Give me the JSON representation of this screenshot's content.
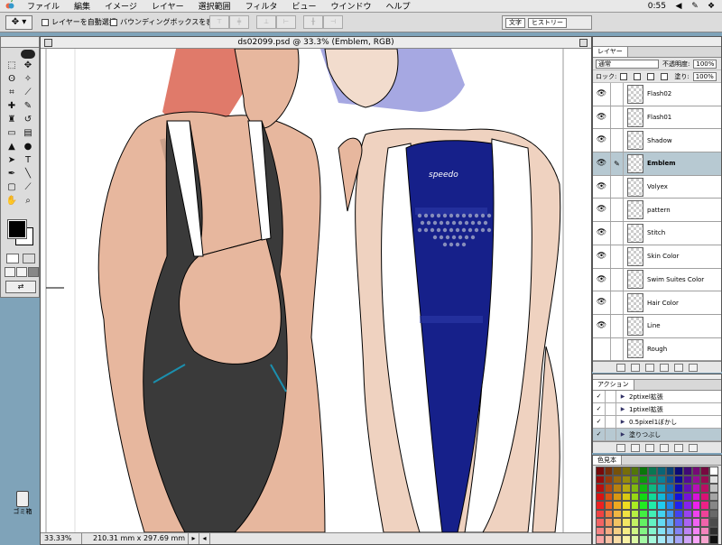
{
  "menubar": {
    "apple": "",
    "items": [
      "ファイル",
      "編集",
      "イメージ",
      "レイヤー",
      "選択範囲",
      "フィルタ",
      "ビュー",
      "ウインドウ",
      "ヘルプ"
    ],
    "clock": "0:55"
  },
  "options": {
    "auto_select": "レイヤーを自動選択",
    "bounding_box": "バウンディングボックスを表示",
    "well_tabs": [
      "文字",
      "ヒストリー"
    ]
  },
  "trash": {
    "label": "ゴミ箱"
  },
  "document": {
    "title": "ds02099.psd @ 33.3% (Emblem, RGB)",
    "zoom": "33.33%",
    "size": "210.31 mm x 297.69 mm",
    "emblem_text": "speedo"
  },
  "layers_palette": {
    "tab": "レイヤー",
    "blend_mode": "通常",
    "opacity_label": "不透明度:",
    "opacity": "100%",
    "lock_label": "ロック:",
    "fill_label": "塗り:",
    "fill": "100%",
    "layers": [
      {
        "name": "Flash02",
        "selected": false
      },
      {
        "name": "Flash01",
        "selected": false
      },
      {
        "name": "Shadow",
        "selected": false
      },
      {
        "name": "Emblem",
        "selected": true
      },
      {
        "name": "Volyex",
        "selected": false
      },
      {
        "name": "pattern",
        "selected": false
      },
      {
        "name": "Stitch",
        "selected": false
      },
      {
        "name": "Skin Color",
        "selected": false
      },
      {
        "name": "Swim Suites Color",
        "selected": false
      },
      {
        "name": "Hair Color",
        "selected": false
      },
      {
        "name": "Line",
        "selected": false
      },
      {
        "name": "Rough",
        "selected": false
      }
    ]
  },
  "actions_palette": {
    "tab": "アクション",
    "actions": [
      {
        "name": "2ptixel拡張",
        "selected": false
      },
      {
        "name": "1ptixel拡張",
        "selected": false
      },
      {
        "name": "0.5pixel1ぼかし",
        "selected": false
      },
      {
        "name": "塗りつぶし",
        "selected": true
      }
    ]
  },
  "swatches_palette": {
    "tab": "色見本"
  },
  "colors": {
    "desktop": "#7fa3b9",
    "suit_blue": "#16208a",
    "suit_black": "#3a3a3a",
    "skin": "#e7b79e",
    "hair_red": "#e07a6a",
    "hair_lilac": "#a6a8e2"
  }
}
